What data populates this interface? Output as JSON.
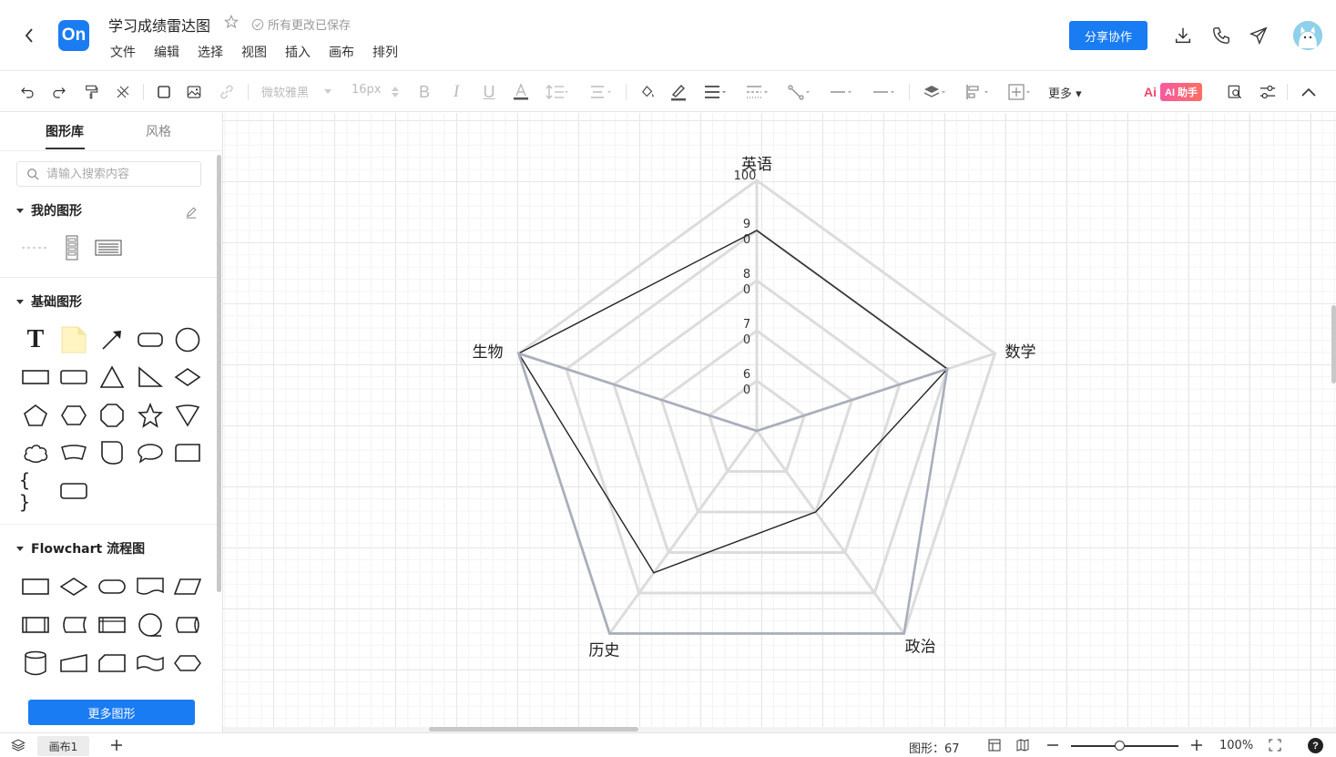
{
  "header": {
    "logo_text": "On",
    "doc_title": "学习成绩雷达图",
    "save_status": "所有更改已保存",
    "menu": [
      "文件",
      "编辑",
      "选择",
      "视图",
      "插入",
      "画布",
      "排列"
    ],
    "share_label": "分享协作"
  },
  "toolbar": {
    "font_family": "微软雅黑",
    "font_size": "16px",
    "more_label": "更多",
    "ai_label": "AI 助手",
    "ai_logo": "Ai"
  },
  "sidebar": {
    "tabs": [
      "图形库",
      "风格"
    ],
    "search_placeholder": "请输入搜索内容",
    "sections": {
      "my_shapes": "我的图形",
      "basic_shapes": "基础图形",
      "flowchart": "Flowchart 流程图"
    },
    "more_shapes_label": "更多图形"
  },
  "statusbar": {
    "page_name": "画布1",
    "shape_count": "图形：67",
    "zoom": "100%",
    "help": "?"
  },
  "chart_data": {
    "type": "radar",
    "axes": [
      "英语",
      "数学",
      "政治",
      "历史",
      "生物"
    ],
    "ticks": [
      "100",
      "9\n0",
      "8\n0",
      "7\n0",
      "6\n0"
    ],
    "tick_values": [
      100,
      90,
      80,
      70,
      60
    ],
    "range": [
      50,
      100
    ],
    "series": [
      {
        "values": [
          90,
          90,
          70,
          85,
          100
        ],
        "color": "#222222"
      },
      {
        "values": [
          50,
          90,
          100,
          100,
          100
        ],
        "color": "#a9aebd"
      }
    ],
    "grid_color": "#dcdcdc"
  }
}
